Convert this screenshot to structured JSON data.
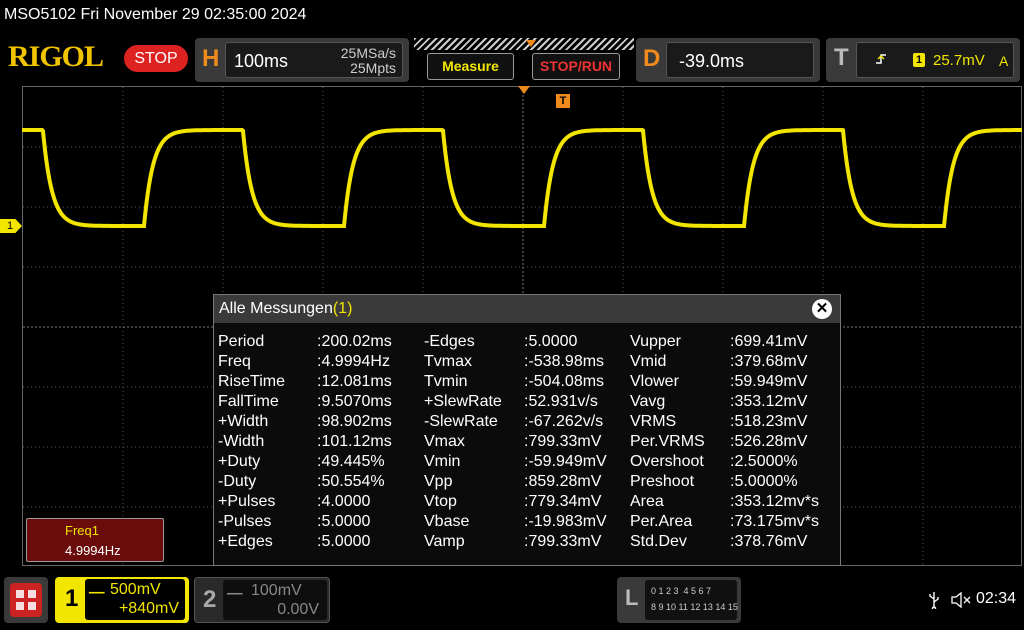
{
  "titlebar": {
    "text": "MSO5102  Fri November 29 02:35:00 2024"
  },
  "logo": "RIGOL",
  "run_state": "STOP",
  "horizontal": {
    "letter": "H",
    "timebase": "100ms",
    "sample_rate": "25MSa/s",
    "memory_depth": "25Mpts"
  },
  "buttons": {
    "measure": "Measure",
    "stop_run": "STOP/RUN"
  },
  "delay": {
    "letter": "D",
    "value": "-39.0ms"
  },
  "trigger": {
    "letter": "T",
    "edge_symbol": "⸗",
    "source": "1",
    "level": "25.7mV",
    "mode": "A"
  },
  "markers": {
    "ch1_marker": "1",
    "trigger_marker": "T"
  },
  "measurements": {
    "title": "Alle Messungen",
    "channel": "(1)",
    "close": "✕",
    "columns": [
      [
        {
          "name": "Period",
          "value": ":200.02ms"
        },
        {
          "name": "Freq",
          "value": ":4.9994Hz"
        },
        {
          "name": "RiseTime",
          "value": ":12.081ms"
        },
        {
          "name": "FallTime",
          "value": ":9.5070ms"
        },
        {
          "name": "+Width",
          "value": ":98.902ms"
        },
        {
          "name": "-Width",
          "value": ":101.12ms"
        },
        {
          "name": "+Duty",
          "value": ":49.445%"
        },
        {
          "name": "-Duty",
          "value": ":50.554%"
        },
        {
          "name": "+Pulses",
          "value": ":4.0000"
        },
        {
          "name": "-Pulses",
          "value": ":5.0000"
        },
        {
          "name": "+Edges",
          "value": ":5.0000"
        }
      ],
      [
        {
          "name": "-Edges",
          "value": ":5.0000"
        },
        {
          "name": "Tvmax",
          "value": ":-538.98ms"
        },
        {
          "name": "Tvmin",
          "value": ":-504.08ms"
        },
        {
          "name": "+SlewRate",
          "value": ":52.931v/s"
        },
        {
          "name": "-SlewRate",
          "value": ":-67.262v/s"
        },
        {
          "name": "Vmax",
          "value": ":799.33mV"
        },
        {
          "name": "Vmin",
          "value": ":-59.949mV"
        },
        {
          "name": "Vpp",
          "value": ":859.28mV"
        },
        {
          "name": "Vtop",
          "value": ":779.34mV"
        },
        {
          "name": "Vbase",
          "value": ":-19.983mV"
        },
        {
          "name": "Vamp",
          "value": ":799.33mV"
        }
      ],
      [
        {
          "name": "Vupper",
          "value": ":699.41mV"
        },
        {
          "name": "Vmid",
          "value": ":379.68mV"
        },
        {
          "name": "Vlower",
          "value": ":59.949mV"
        },
        {
          "name": "Vavg",
          "value": ":353.12mV"
        },
        {
          "name": "VRMS",
          "value": ":518.23mV"
        },
        {
          "name": "Per.VRMS",
          "value": ":526.28mV"
        },
        {
          "name": "Overshoot",
          "value": ":2.5000%"
        },
        {
          "name": "Preshoot",
          "value": ":5.0000%"
        },
        {
          "name": "Area",
          "value": ":353.12mv*s"
        },
        {
          "name": "Per.Area",
          "value": ":73.175mv*s"
        },
        {
          "name": "Std.Dev",
          "value": ":378.76mV"
        }
      ]
    ]
  },
  "freq_box": {
    "label": "Freq1",
    "value": "4.9994Hz"
  },
  "ch1": {
    "number": "1",
    "scale": "500mV",
    "offset": "+840mV",
    "color": "#f2e600"
  },
  "ch2": {
    "number": "2",
    "scale": "100mV",
    "offset": "0.00V"
  },
  "logic": {
    "letter": "L",
    "row1": "0 1 2 3  4 5 6 7",
    "row2": "8 9 10 11 12 13 14 15"
  },
  "status": {
    "usb_icon": "usb-icon",
    "sound_icon": "speaker-muted-icon",
    "time": "02:34"
  },
  "waveform": {
    "color": "#f2e600",
    "high_level_mV": 779.34,
    "low_level_mV": -19.983,
    "period_ms": 200.02,
    "duty_percent": 49.445
  }
}
